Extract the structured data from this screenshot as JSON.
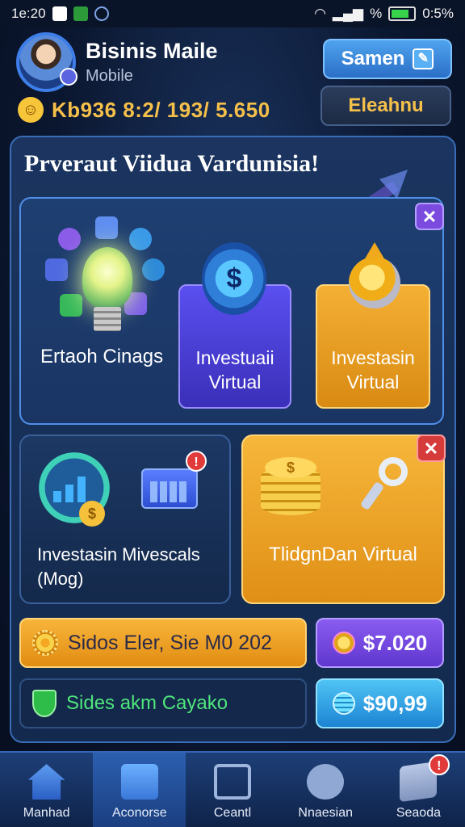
{
  "status_bar": {
    "time": "1e:20",
    "battery_pct": "0:5%",
    "signal_text": "%"
  },
  "profile": {
    "name": "Bisinis Maile",
    "subtitle": "Mobile",
    "stats": "Kb936 8:2/ 193/ 5.650"
  },
  "header_buttons": {
    "primary": "Samen",
    "secondary": "Eleahnu"
  },
  "panel": {
    "title": "Prveraut Viidua Vardunisia!"
  },
  "feature_box": {
    "left_label": "Ertaoh Cinags",
    "blue_card": {
      "line1": "Investuaii",
      "line2": "Virtual"
    },
    "gold_card": {
      "line1": "Investasin",
      "line2": "Virtual"
    }
  },
  "lower_cards": {
    "invest": {
      "line1": "Investasin Mivescals",
      "line2": "(Mog)"
    },
    "trading": {
      "label": "TlidgnDan Virtual"
    }
  },
  "bars": {
    "orange": "Sidos Eler, Sie M0  202",
    "purple_value": "$7.020",
    "dark": "Sides akm Cayako",
    "cyan_value": "$90,99"
  },
  "bottom_nav": [
    {
      "label": "Manhad"
    },
    {
      "label": "Aconorse"
    },
    {
      "label": "Ceantl"
    },
    {
      "label": "Nnaesian"
    },
    {
      "label": "Seaoda"
    }
  ],
  "icons": {
    "badge_symbol": "$",
    "coin_symbol": "$",
    "close_symbol": "✕",
    "notif_symbol": "!",
    "smiley": "☺",
    "edit": "✎"
  }
}
